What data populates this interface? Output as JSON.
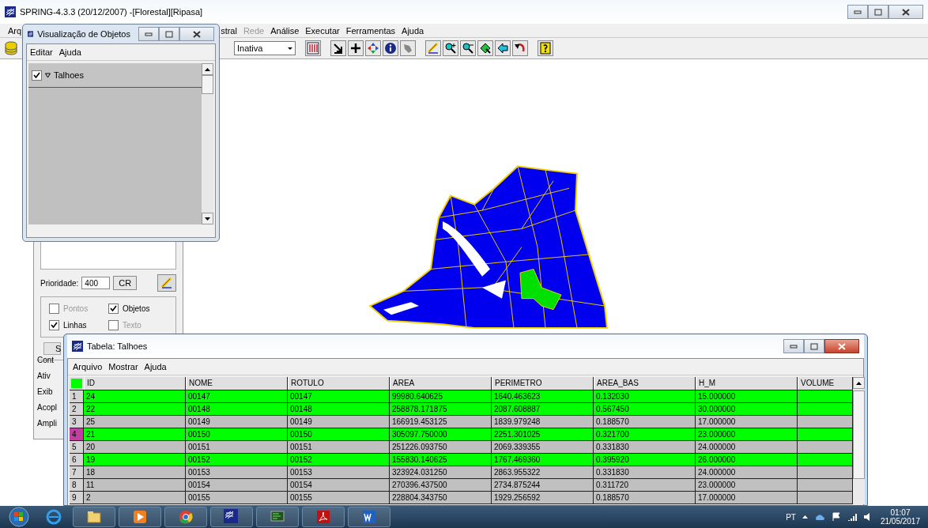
{
  "window": {
    "title": "SPRING-4.3.3 (20/12/2007) -[Florestal][Ripasa]"
  },
  "menu": [
    {
      "label": "Arq",
      "disabled": false
    },
    {
      "label": "stral",
      "disabled": false
    },
    {
      "label": "Rede",
      "disabled": true
    },
    {
      "label": "Análise",
      "disabled": false
    },
    {
      "label": "Executar",
      "disabled": false
    },
    {
      "label": "Ferramentas",
      "disabled": false
    },
    {
      "label": "Ajuda",
      "disabled": false
    }
  ],
  "toolbar": {
    "mode_select": {
      "value": "Inativa"
    }
  },
  "objects_window": {
    "title": "Visualização de Objetos",
    "menu": [
      "Editar",
      "Ajuda"
    ],
    "tree": [
      {
        "label": "Talhoes",
        "checked": true
      }
    ]
  },
  "control_panel": {
    "priority_label": "Prioridade:",
    "priority": "400",
    "cr_button": "CR",
    "options": [
      {
        "label": "Pontos",
        "checked": false,
        "disabled": true
      },
      {
        "label": "Objetos",
        "checked": true,
        "disabled": false
      },
      {
        "label": "Linhas",
        "checked": true,
        "disabled": false
      },
      {
        "label": "Texto",
        "checked": false,
        "disabled": true
      }
    ],
    "tab_fragment": "S",
    "group_label": "Cont",
    "rows": [
      "Ativ",
      "Exib",
      "Acopl",
      "Ampli"
    ]
  },
  "table_window": {
    "title": "Tabela: Talhoes",
    "menu": [
      "Arquivo",
      "Mostrar",
      "Ajuda"
    ],
    "columns": [
      "ID",
      "NOME",
      "ROTULO",
      "AREA",
      "PERIMETRO",
      "AREA_BAS",
      "H_M",
      "VOLUME"
    ],
    "rows": [
      {
        "number": "1",
        "selected": true,
        "current": false,
        "cells": [
          "24",
          "00147",
          "00147",
          "99980.640625",
          "1640.463623",
          "0.132030",
          "15.000000",
          ""
        ]
      },
      {
        "number": "2",
        "selected": true,
        "current": false,
        "cells": [
          "22",
          "00148",
          "00148",
          "258878.171875",
          "2087.608887",
          "0.567450",
          "30.000000",
          ""
        ]
      },
      {
        "number": "3",
        "selected": false,
        "current": false,
        "cells": [
          "25",
          "00149",
          "00149",
          "166919.453125",
          "1839.979248",
          "0.188570",
          "17.000000",
          ""
        ]
      },
      {
        "number": "4",
        "selected": true,
        "current": true,
        "cells": [
          "21",
          "00150",
          "00150",
          "305097.750000",
          "2251.301025",
          "0.321700",
          "23.000000",
          ""
        ]
      },
      {
        "number": "5",
        "selected": false,
        "current": false,
        "cells": [
          "20",
          "00151",
          "00151",
          "251226.093750",
          "2069.339355",
          "0.331830",
          "24.000000",
          ""
        ]
      },
      {
        "number": "6",
        "selected": true,
        "current": false,
        "cells": [
          "19",
          "00152",
          "00152",
          "155830.140625",
          "1767.469360",
          "0.395920",
          "26.000000",
          ""
        ]
      },
      {
        "number": "7",
        "selected": false,
        "current": false,
        "cells": [
          "18",
          "00153",
          "00153",
          "323924.031250",
          "2863.955322",
          "0.331830",
          "24.000000",
          ""
        ]
      },
      {
        "number": "8",
        "selected": false,
        "current": false,
        "cells": [
          "11",
          "00154",
          "00154",
          "270396.437500",
          "2734.875244",
          "0.311720",
          "23.000000",
          ""
        ]
      },
      {
        "number": "9",
        "selected": false,
        "current": false,
        "cells": [
          "2",
          "00155",
          "00155",
          "228804.343750",
          "1929.256592",
          "0.188570",
          "17.000000",
          ""
        ]
      }
    ]
  },
  "taskbar": {
    "language": "PT",
    "time": "01:07",
    "date": "21/05/2017"
  }
}
